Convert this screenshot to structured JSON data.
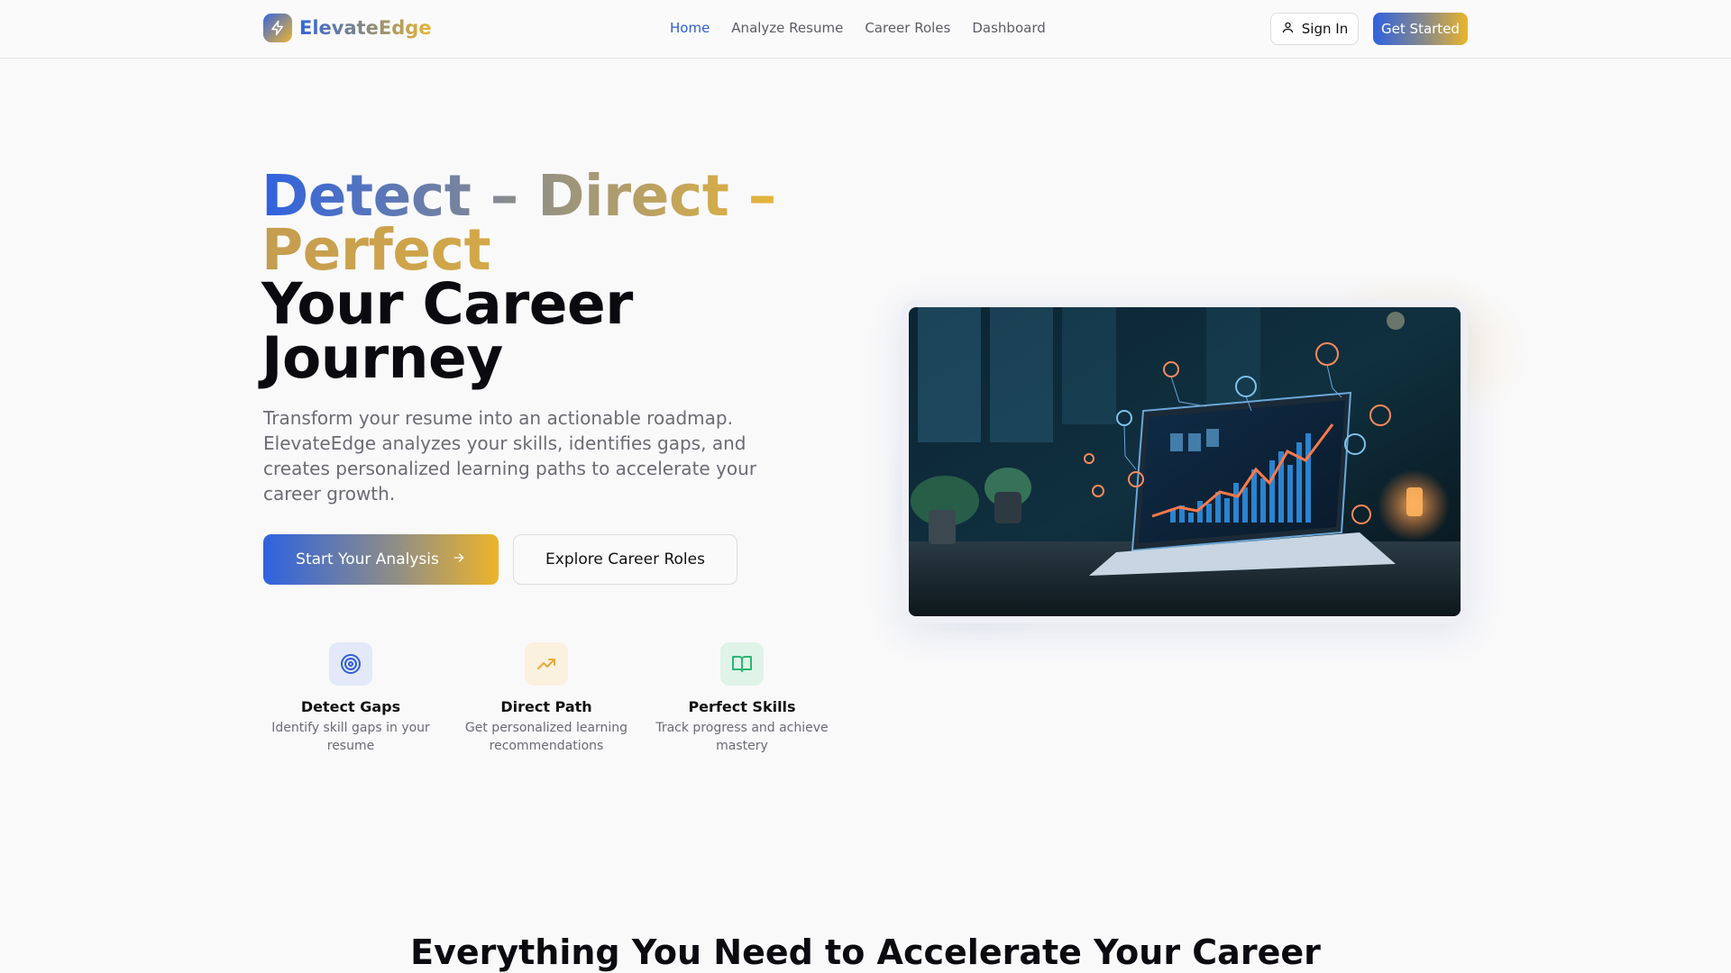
{
  "brand": {
    "name": "ElevateEdge"
  },
  "nav": {
    "links": [
      "Home",
      "Analyze Resume",
      "Career Roles",
      "Dashboard"
    ],
    "active": "Home",
    "sign_in": "Sign In",
    "get_started": "Get Started"
  },
  "hero": {
    "headline_line1": "Detect – Direct –",
    "headline_line2": "Perfect",
    "headline_line3": "Your Career",
    "headline_line4": "Journey",
    "subtext": "Transform your resume into an actionable roadmap. ElevateEdge analyzes your skills, identifies gaps, and creates personalized learning paths to accelerate your career growth.",
    "primary_cta": "Start Your Analysis",
    "secondary_cta": "Explore Career Roles"
  },
  "features": [
    {
      "title": "Detect Gaps",
      "desc": "Identify skill gaps in your resume",
      "icon": "target-icon",
      "color": "#2f5fd4",
      "bg": "#e3e9f8"
    },
    {
      "title": "Direct Path",
      "desc": "Get personalized learning recommendations",
      "icon": "trending-up-icon",
      "color": "#e9a93a",
      "bg": "#fbf1df"
    },
    {
      "title": "Perfect Skills",
      "desc": "Track progress and achieve mastery",
      "icon": "book-open-icon",
      "color": "#2bb673",
      "bg": "#dff3e8"
    }
  ],
  "section": {
    "heading": "Everything You Need to Accelerate Your Career"
  }
}
